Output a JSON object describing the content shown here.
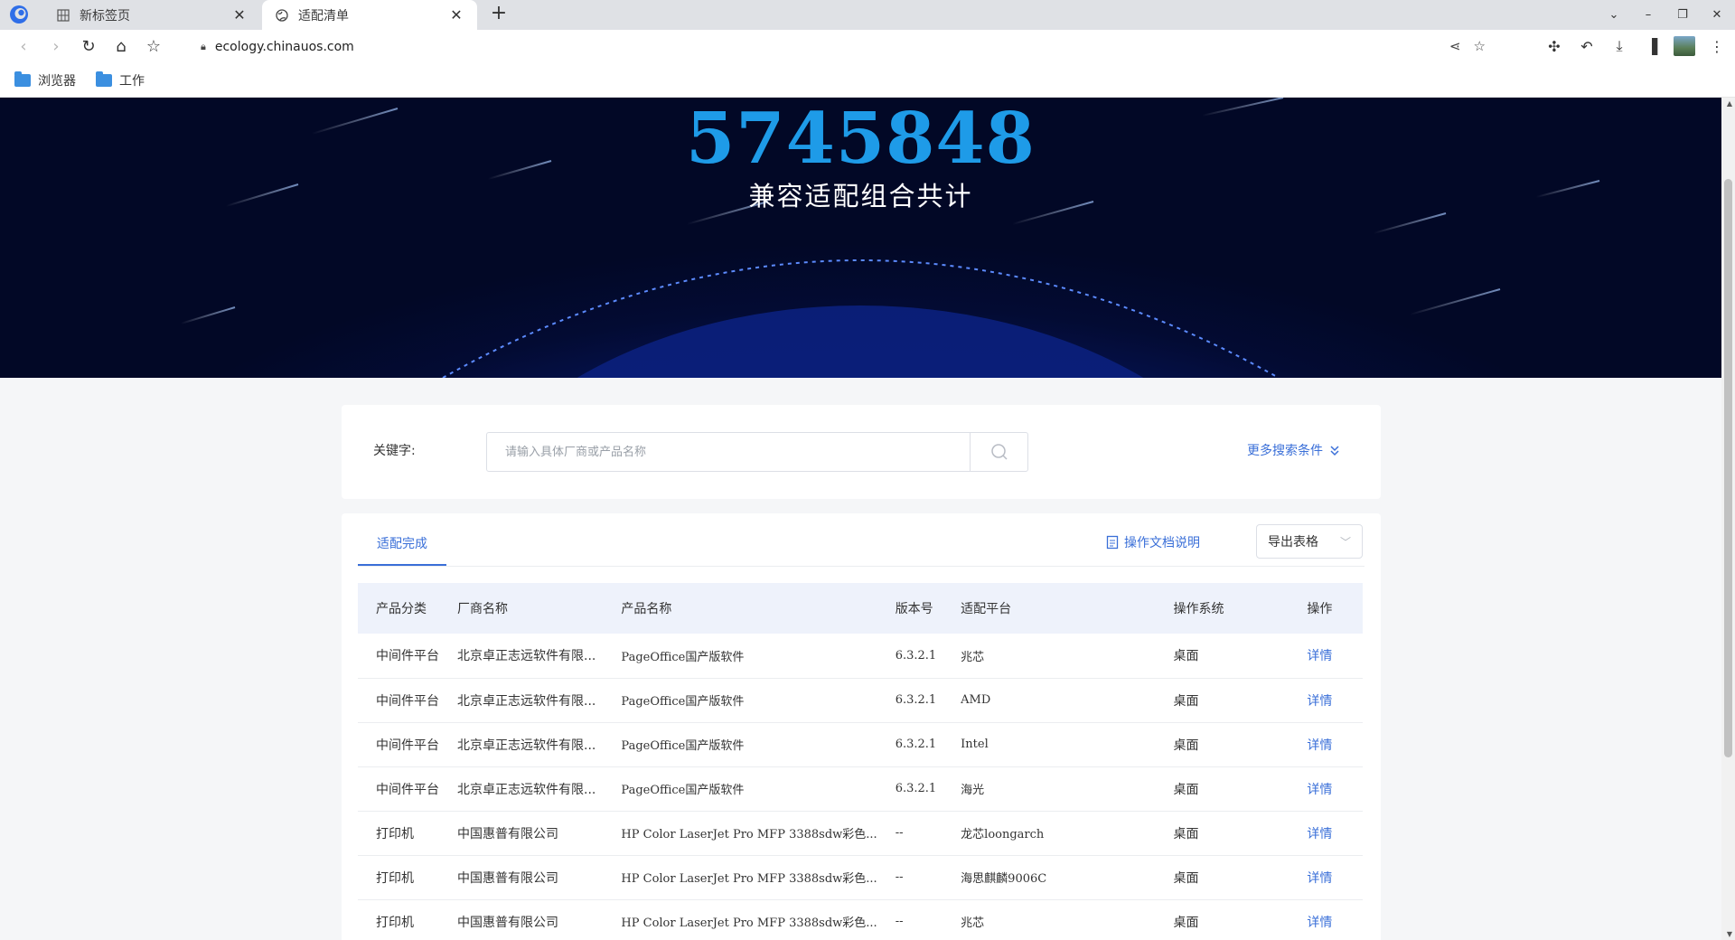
{
  "browser": {
    "tabs": [
      {
        "title": "新标签页",
        "icon": "grid-icon"
      },
      {
        "title": "适配清单",
        "icon": "globe-icon"
      }
    ],
    "url": "ecology.chinauos.com",
    "bookmarks": [
      {
        "label": "浏览器",
        "icon": "folder-icon"
      },
      {
        "label": "工作",
        "icon": "folder-icon"
      }
    ]
  },
  "hero": {
    "count": "5745848",
    "subtitle": "兼容适配组合共计"
  },
  "search": {
    "label": "关键字:",
    "placeholder": "请输入具体厂商或产品名称",
    "more_label": "更多搜索条件"
  },
  "list": {
    "active_tab": "适配完成",
    "doc_link": "操作文档说明",
    "export_label": "导出表格",
    "columns": [
      "产品分类",
      "厂商名称",
      "产品名称",
      "版本号",
      "适配平台",
      "操作系统",
      "操作"
    ],
    "rows": [
      {
        "category": "中间件平台",
        "vendor": "北京卓正志远软件有限...",
        "product": "PageOffice国产版软件",
        "version": "6.3.2.1",
        "platform": "兆芯",
        "os": "桌面",
        "action": "详情"
      },
      {
        "category": "中间件平台",
        "vendor": "北京卓正志远软件有限...",
        "product": "PageOffice国产版软件",
        "version": "6.3.2.1",
        "platform": "AMD",
        "os": "桌面",
        "action": "详情"
      },
      {
        "category": "中间件平台",
        "vendor": "北京卓正志远软件有限...",
        "product": "PageOffice国产版软件",
        "version": "6.3.2.1",
        "platform": "Intel",
        "os": "桌面",
        "action": "详情"
      },
      {
        "category": "中间件平台",
        "vendor": "北京卓正志远软件有限...",
        "product": "PageOffice国产版软件",
        "version": "6.3.2.1",
        "platform": "海光",
        "os": "桌面",
        "action": "详情"
      },
      {
        "category": "打印机",
        "vendor": "中国惠普有限公司",
        "product": "HP Color LaserJet Pro MFP 3388sdw彩色...",
        "version": "--",
        "platform": "龙芯loongarch",
        "os": "桌面",
        "action": "详情"
      },
      {
        "category": "打印机",
        "vendor": "中国惠普有限公司",
        "product": "HP Color LaserJet Pro MFP 3388sdw彩色...",
        "version": "--",
        "platform": "海思麒麟9006C",
        "os": "桌面",
        "action": "详情"
      },
      {
        "category": "打印机",
        "vendor": "中国惠普有限公司",
        "product": "HP Color LaserJet Pro MFP 3388sdw彩色...",
        "version": "--",
        "platform": "兆芯",
        "os": "桌面",
        "action": "详情"
      }
    ]
  },
  "colors": {
    "accent": "#3a6fd8",
    "count": "#1e9be8",
    "hero_bg": "#030b33"
  }
}
